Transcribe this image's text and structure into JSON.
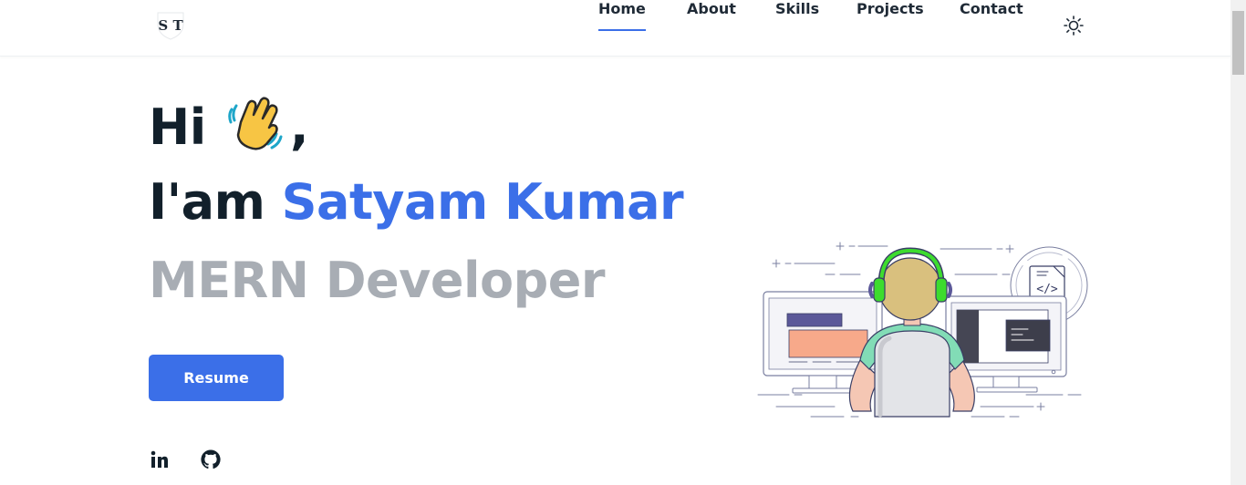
{
  "header": {
    "logo_text": "S T",
    "nav": [
      {
        "label": "Home",
        "active": true
      },
      {
        "label": "About",
        "active": false
      },
      {
        "label": "Skills",
        "active": false
      },
      {
        "label": "Projects",
        "active": false
      },
      {
        "label": "Contact",
        "active": false
      }
    ],
    "theme_icon": "sun-icon"
  },
  "hero": {
    "greeting": "Hi",
    "greeting_suffix": ",",
    "wave_icon": "waving-hand-icon",
    "intro_prefix": "I'am",
    "name": "Satyam Kumar",
    "role": "MERN Developer",
    "resume_label": "Resume"
  },
  "social": [
    {
      "name": "linkedin-icon"
    },
    {
      "name": "github-icon"
    }
  ],
  "illustration": {
    "code_tag": "</>",
    "icon": "developer-illustration"
  },
  "colors": {
    "accent": "#3b6fe8",
    "dark_text": "#12202b",
    "muted_text": "#a8adb4",
    "headset": "#3ddc2e"
  }
}
